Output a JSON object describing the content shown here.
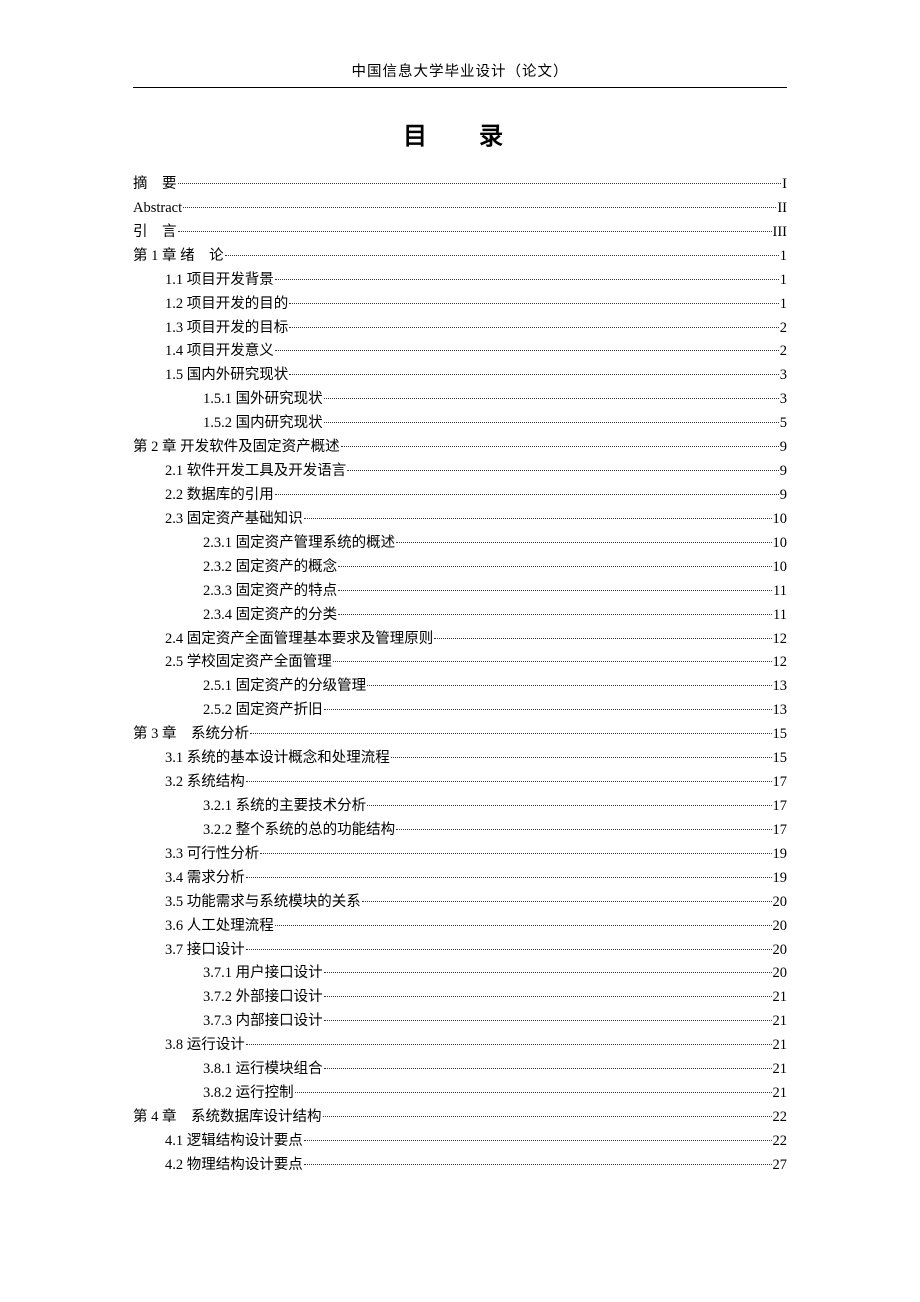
{
  "header": "中国信息大学毕业设计（论文）",
  "title": "目　录",
  "entries": [
    {
      "indent": 0,
      "label": "摘　要",
      "page": "I"
    },
    {
      "indent": 0,
      "label": "Abstract",
      "page": "II"
    },
    {
      "indent": 0,
      "label": "引　言",
      "page": "III"
    },
    {
      "indent": 0,
      "label": "第 1 章 绪　论",
      "page": "1"
    },
    {
      "indent": 1,
      "label": "1.1 项目开发背景",
      "page": "1"
    },
    {
      "indent": 1,
      "label": "1.2 项目开发的目的",
      "page": "1"
    },
    {
      "indent": 1,
      "label": "1.3 项目开发的目标",
      "page": "2"
    },
    {
      "indent": 1,
      "label": "1.4 项目开发意义",
      "page": "2"
    },
    {
      "indent": 1,
      "label": "1.5 国内外研究现状",
      "page": "3"
    },
    {
      "indent": 2,
      "label": "1.5.1 国外研究现状",
      "page": "3"
    },
    {
      "indent": 2,
      "label": "1.5.2 国内研究现状",
      "page": "5"
    },
    {
      "indent": 0,
      "label": "第 2 章 开发软件及固定资产概述",
      "page": "9"
    },
    {
      "indent": 1,
      "label": "2.1 软件开发工具及开发语言",
      "page": "9"
    },
    {
      "indent": 1,
      "label": "2.2 数据库的引用",
      "page": "9"
    },
    {
      "indent": 1,
      "label": "2.3 固定资产基础知识",
      "page": "10"
    },
    {
      "indent": 2,
      "label": "2.3.1 固定资产管理系统的概述",
      "page": "10"
    },
    {
      "indent": 2,
      "label": "2.3.2 固定资产的概念",
      "page": "10"
    },
    {
      "indent": 2,
      "label": "2.3.3 固定资产的特点",
      "page": "11"
    },
    {
      "indent": 2,
      "label": "2.3.4 固定资产的分类",
      "page": "11"
    },
    {
      "indent": 1,
      "label": "2.4 固定资产全面管理基本要求及管理原则",
      "page": "12"
    },
    {
      "indent": 1,
      "label": "2.5 学校固定资产全面管理",
      "page": "12"
    },
    {
      "indent": 2,
      "label": "2.5.1 固定资产的分级管理",
      "page": "13"
    },
    {
      "indent": 2,
      "label": "2.5.2 固定资产折旧",
      "page": "13"
    },
    {
      "indent": 0,
      "label": "第 3 章　系统分析",
      "page": "15"
    },
    {
      "indent": 1,
      "label": "3.1 系统的基本设计概念和处理流程",
      "page": "15"
    },
    {
      "indent": 1,
      "label": "3.2 系统结构",
      "page": "17"
    },
    {
      "indent": 2,
      "label": "3.2.1 系统的主要技术分析",
      "page": "17"
    },
    {
      "indent": 2,
      "label": "3.2.2 整个系统的总的功能结构",
      "page": "17"
    },
    {
      "indent": 1,
      "label": "3.3 可行性分析",
      "page": "19"
    },
    {
      "indent": 1,
      "label": "3.4 需求分析",
      "page": "19"
    },
    {
      "indent": 1,
      "label": "3.5 功能需求与系统模块的关系",
      "page": "20"
    },
    {
      "indent": 1,
      "label": "3.6 人工处理流程",
      "page": "20"
    },
    {
      "indent": 1,
      "label": "3.7 接口设计",
      "page": "20"
    },
    {
      "indent": 2,
      "label": "3.7.1 用户接口设计",
      "page": "20"
    },
    {
      "indent": 2,
      "label": "3.7.2 外部接口设计",
      "page": "21"
    },
    {
      "indent": 2,
      "label": "3.7.3 内部接口设计",
      "page": "21"
    },
    {
      "indent": 1,
      "label": "3.8 运行设计",
      "page": "21"
    },
    {
      "indent": 2,
      "label": "3.8.1 运行模块组合",
      "page": "21"
    },
    {
      "indent": 2,
      "label": "3.8.2 运行控制",
      "page": "21"
    },
    {
      "indent": 0,
      "label": "第 4 章　系统数据库设计结构",
      "page": "22"
    },
    {
      "indent": 1,
      "label": "4.1 逻辑结构设计要点",
      "page": "22"
    },
    {
      "indent": 1,
      "label": "4.2 物理结构设计要点",
      "page": "27"
    }
  ]
}
